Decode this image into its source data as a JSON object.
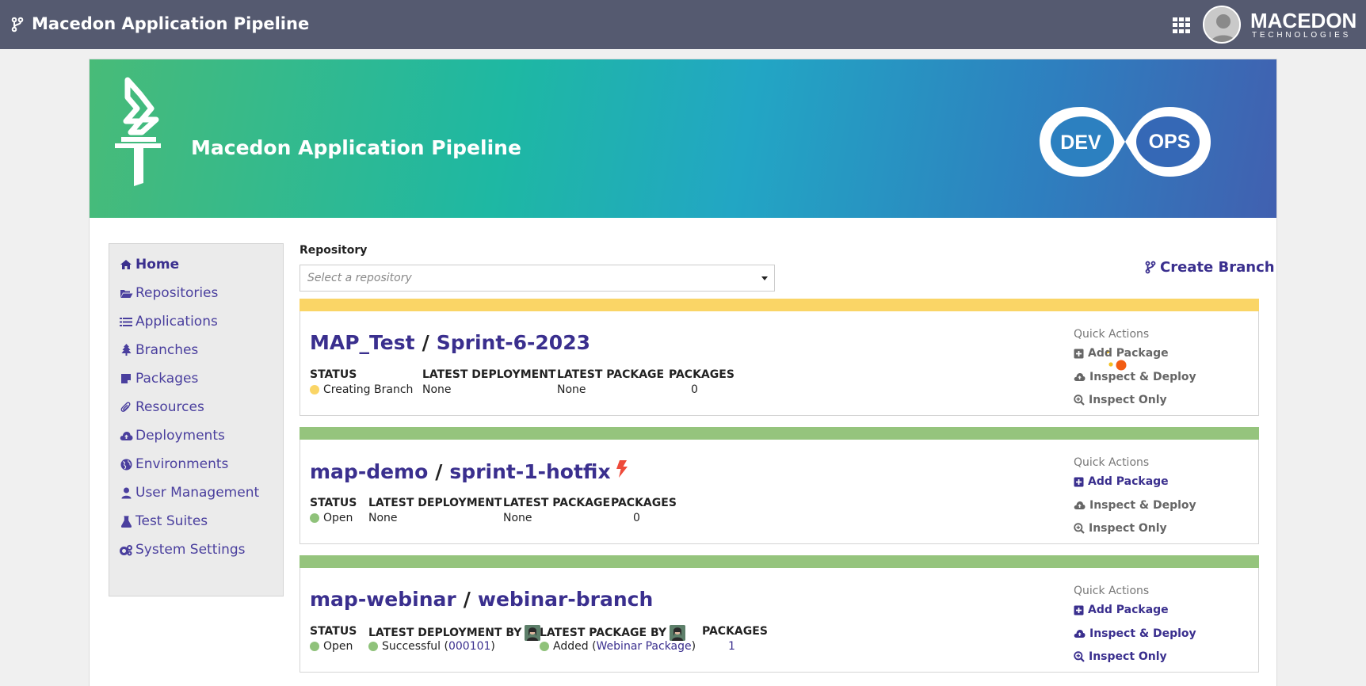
{
  "topbar": {
    "title": "Macedon Application Pipeline",
    "logo_main": "MACEDON",
    "logo_sub": "TECHNOLOGIES"
  },
  "banner": {
    "title": "Macedon Application Pipeline",
    "devops_left": "DEV",
    "devops_right": "OPS"
  },
  "sidebar": {
    "items": [
      {
        "label": "Home",
        "icon": "home-icon"
      },
      {
        "label": "Repositories",
        "icon": "folder-open-icon"
      },
      {
        "label": "Applications",
        "icon": "list-icon"
      },
      {
        "label": "Branches",
        "icon": "tree-icon"
      },
      {
        "label": "Packages",
        "icon": "sticky-note-icon"
      },
      {
        "label": "Resources",
        "icon": "paperclip-icon"
      },
      {
        "label": "Deployments",
        "icon": "cloud-upload-icon"
      },
      {
        "label": "Environments",
        "icon": "globe-icon"
      },
      {
        "label": "User Management",
        "icon": "user-icon"
      },
      {
        "label": "Test Suites",
        "icon": "flask-icon"
      },
      {
        "label": "System Settings",
        "icon": "cogs-icon"
      }
    ]
  },
  "repository": {
    "label": "Repository",
    "placeholder": "Select a repository"
  },
  "create_branch_label": "Create Branch",
  "quick_actions": {
    "title": "Quick Actions",
    "add_package": "Add Package",
    "inspect_deploy": "Inspect & Deploy",
    "inspect_only": "Inspect Only"
  },
  "columns": {
    "status": "STATUS",
    "latest_deployment": "LATEST DEPLOYMENT",
    "latest_deployment_by": "LATEST DEPLOYMENT BY",
    "latest_package": "LATEST PACKAGE",
    "latest_package_by": "LATEST PACKAGE BY",
    "packages": "PACKAGES"
  },
  "branches": [
    {
      "repo": "MAP_Test",
      "branch": "Sprint-6-2023",
      "stripe_color": "#fad566",
      "status": "Creating Branch",
      "latest_deployment": "None",
      "latest_package": "None",
      "packages": "0"
    },
    {
      "repo": "map-demo",
      "branch": "sprint-1-hotfix",
      "stripe_color": "#95c47d",
      "status": "Open",
      "latest_deployment": "None",
      "latest_package": "None",
      "packages": "0"
    },
    {
      "repo": "map-webinar",
      "branch": "webinar-branch",
      "stripe_color": "#95c47d",
      "status": "Open",
      "deployment_status": "Successful",
      "deployment_open": "(",
      "deployment_id": "000101",
      "deployment_close": ")",
      "package_status": "Added",
      "package_open": "(",
      "package_name": "Webinar Package",
      "package_close": ")",
      "packages": "1"
    }
  ]
}
